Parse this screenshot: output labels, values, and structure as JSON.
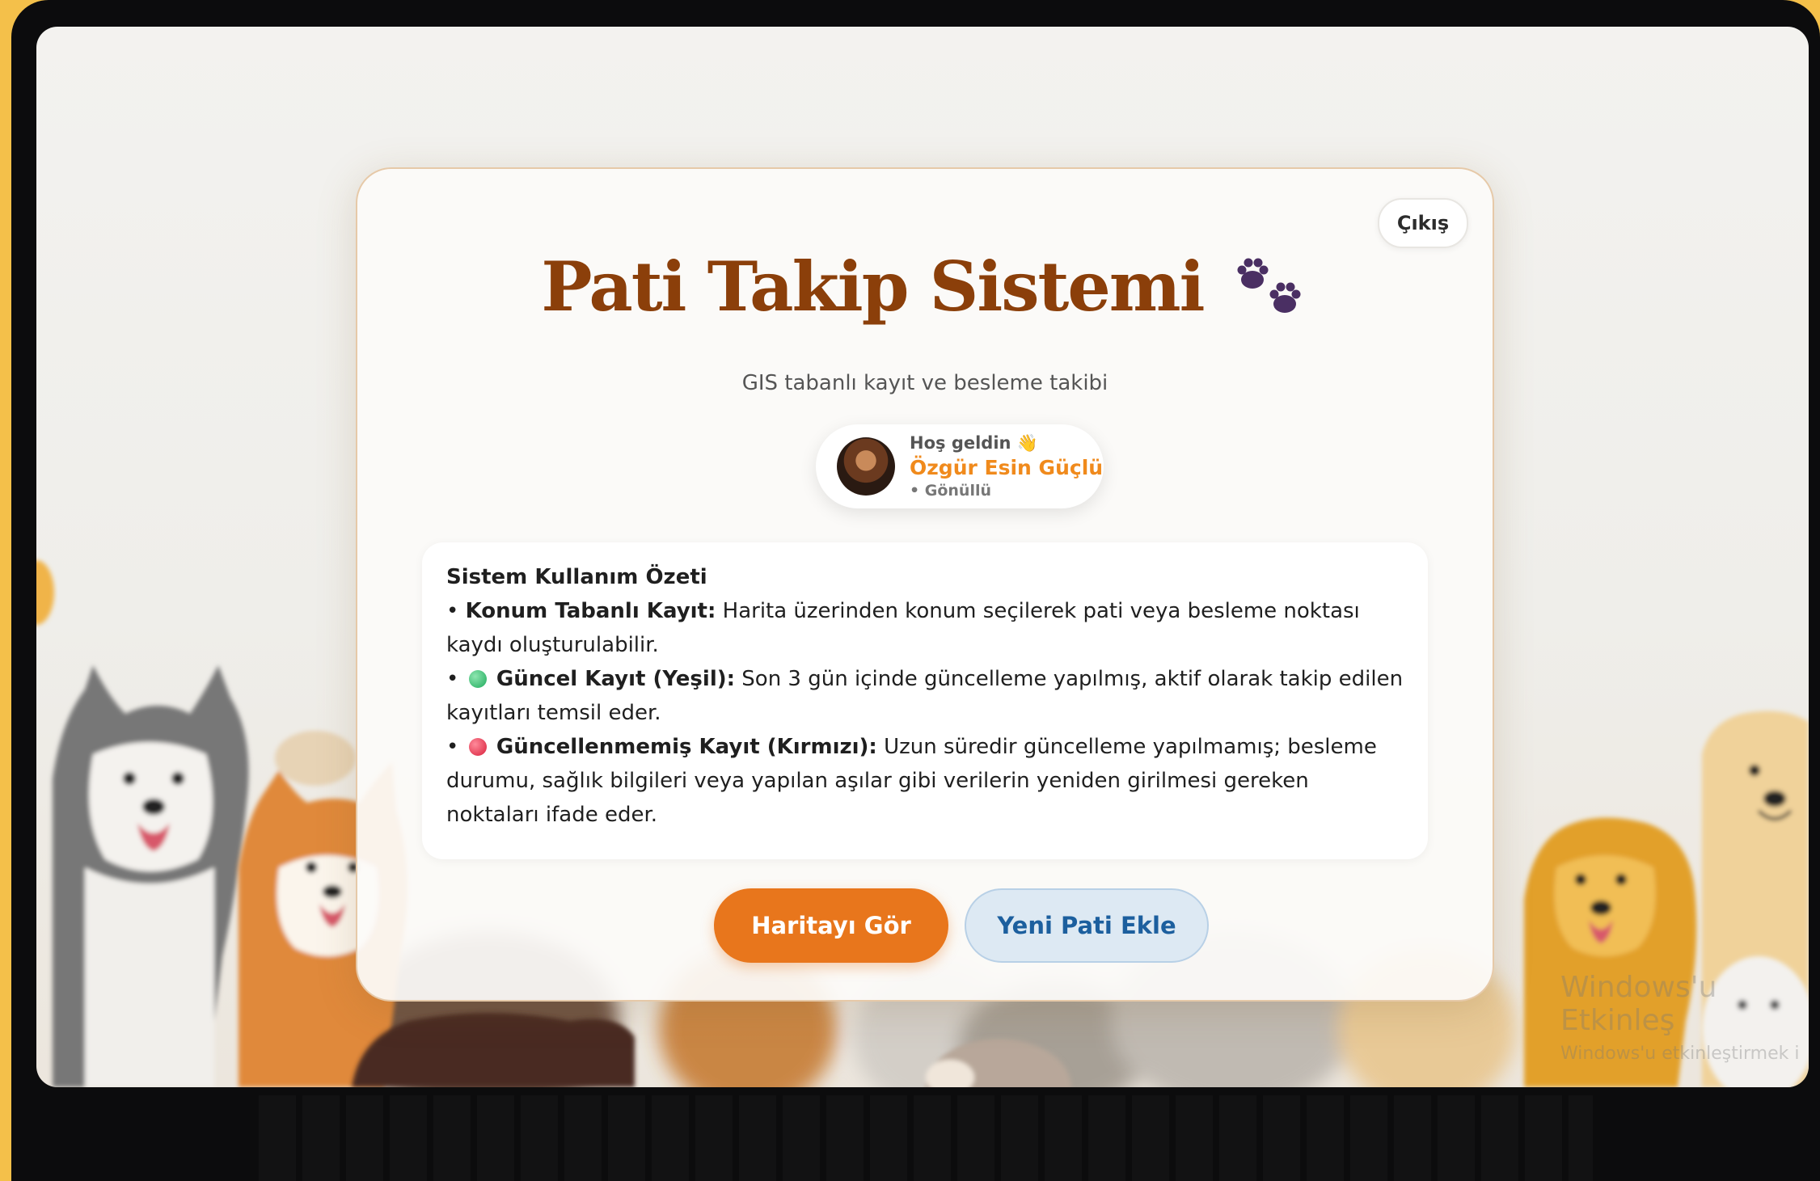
{
  "app": {
    "title": "Pati Takip Sistemi",
    "subtitle": "GIS tabanlı kayıt ve besleme takibi",
    "logout_label": "Çıkış"
  },
  "user": {
    "greeting": "Hoş geldin 👋",
    "name": "Özgür Esin Güçlü",
    "role": "• Gönüllü"
  },
  "summary": {
    "heading": "Sistem Kullanım Özeti",
    "item1_bullet": "• ",
    "item1_label": "Konum Tabanlı Kayıt:",
    "item1_text": " Harita üzerinden konum seçilerek pati veya besleme noktası kaydı oluşturulabilir.",
    "item2_bullet": "• ",
    "item2_label": "Güncel Kayıt (Yeşil):",
    "item2_text": " Son 3 gün içinde güncelleme yapılmış, aktif olarak takip edilen kayıtları temsil eder.",
    "item3_bullet": "• ",
    "item3_label": "Güncellenmemiş Kayıt (Kırmızı):",
    "item3_text": " Uzun süredir güncelleme yapılmamış; besleme durumu, sağlık bilgileri veya yapılan aşılar gibi verilerin yeniden girilmesi gereken noktaları ifade eder."
  },
  "buttons": {
    "map": "Haritayı Gör",
    "add": "Yeni Pati Ekle"
  },
  "watermark": {
    "line1": "Windows'u Etkinleş",
    "line2": "Windows'u etkinleştirmek i"
  },
  "colors": {
    "title": "#8b3f0a",
    "accent_orange": "#e8761c",
    "name_orange": "#f08a1c",
    "secondary_blue": "#1c5f9e",
    "paw": "#4a2f63",
    "status_green": "#1eaa5c",
    "status_red": "#d81f3b"
  },
  "icons": {
    "paw": "paw-prints-icon",
    "wave": "waving-hand-icon",
    "green_dot": "green-circle-icon",
    "red_dot": "red-circle-icon"
  }
}
